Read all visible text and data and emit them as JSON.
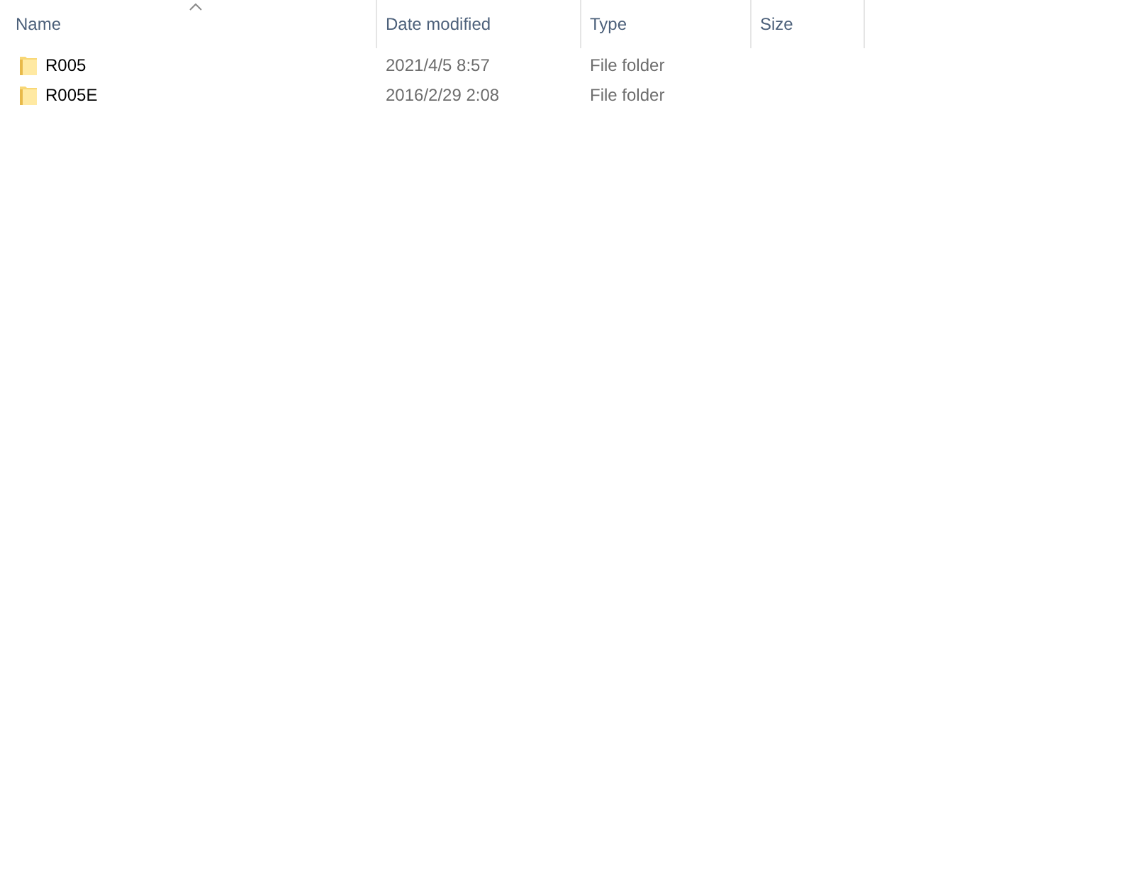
{
  "columns": [
    {
      "label": "Name",
      "sorted": true
    },
    {
      "label": "Date modified",
      "sorted": false
    },
    {
      "label": "Type",
      "sorted": false
    },
    {
      "label": "Size",
      "sorted": false
    }
  ],
  "rows": [
    {
      "kind": "folder",
      "name": "R005",
      "date_modified": "2021/4/5 8:57",
      "type": "File folder"
    },
    {
      "kind": "folder",
      "name": "R005E",
      "date_modified": "2016/2/29 2:08",
      "type": "File folder"
    }
  ]
}
